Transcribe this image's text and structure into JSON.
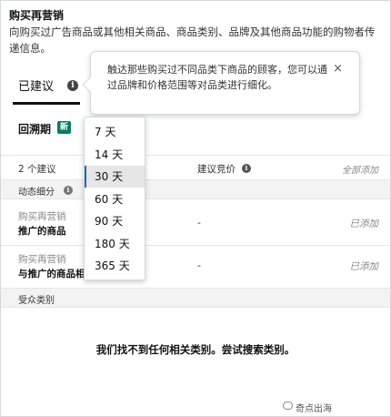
{
  "header": {
    "title": "购买再营销",
    "description": "向购买过广告商品或其他相关商品、商品类别、品牌及其他商品功能的购物者传递信息。"
  },
  "suggested_tab": {
    "label": "已建议"
  },
  "tooltip": {
    "text": "触达那些购买过不同品类下商品的顾客，您可以通过品牌和价格范围等对品类进行细化。",
    "close": "×"
  },
  "lookback": {
    "label": "回溯期",
    "badge": "新"
  },
  "lookback_options": [
    "7 天",
    "14 天",
    "30 天",
    "60 天",
    "90 天",
    "180 天",
    "365 天"
  ],
  "lookback_selected": "30 天",
  "table": {
    "count": "2 个建议",
    "bid_header": "建议竞价",
    "add_all": "全部添加"
  },
  "sections": {
    "dynamic": "动态细分",
    "audience": "受众类别"
  },
  "rows": [
    {
      "line1": "购买再营销",
      "line2": "推广的商品",
      "bid": "-",
      "status": "已添加"
    },
    {
      "line1": "购买再营销",
      "line2": "与推广的商品相似",
      "bid": "-",
      "status": "已添加"
    }
  ],
  "empty_message": "我们找不到任何相关类别。尝试搜索类别。",
  "watermark": "奇点出海"
}
